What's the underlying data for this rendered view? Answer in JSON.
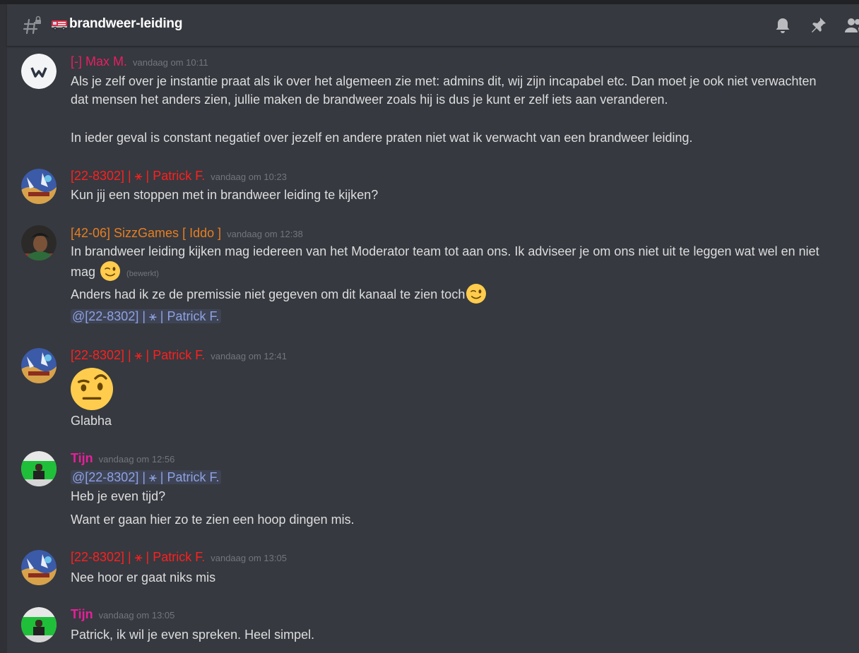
{
  "channel": {
    "name": "brandweer-leiding",
    "icon": "fire-truck-emoji"
  },
  "header_icons": [
    "bell-icon",
    "pin-icon",
    "members-icon"
  ],
  "colors": {
    "background": "#36393f",
    "text": "#dcddde",
    "timestamp": "#72767d",
    "mention": "#8ea1e1",
    "author_max": "#e91e63",
    "author_patrick": "#ff1f1f",
    "author_sizz": "#e67e22",
    "author_tijn": "#e91e9c"
  },
  "messages": [
    {
      "author": "[-] Max M.",
      "time": "vandaag om 10:11",
      "lines": [
        "Als je zelf over je instantie praat als ik over het algemeen zie met: admins dit, wij zijn incapabel etc. Dan moet je ook niet verwachten",
        "dat mensen het anders zien, jullie maken de brandweer zoals hij is dus je kunt er zelf iets aan veranderen.",
        "In ieder geval is constant negatief over jezelf en andere praten niet wat ik verwacht van een brandweer leiding."
      ]
    },
    {
      "author": "[22-8302] | ⚹ | Patrick F.",
      "time": "vandaag om 10:23",
      "lines": [
        "Kun jij een stoppen met in brandweer leiding te kijken?"
      ]
    },
    {
      "author": "[42-06] SizzGames [ Iddo ]",
      "time": "vandaag om 12:38",
      "lines": [
        "In brandweer leiding kijken mag iedereen van het Moderator team tot aan ons. Ik adviseer je om ons niet uit te leggen wat wel en niet",
        "mag",
        "Anders had ik ze de premissie niet gegeven om dit kanaal te zien toch"
      ],
      "edited": "(bewerkt)",
      "mention": "@[22-8302] | ⚹ | Patrick F."
    },
    {
      "author": "[22-8302] | ⚹ | Patrick F.",
      "time": "vandaag om 12:41",
      "emoji": "raised-eyebrow-emoji",
      "lines": [
        "Glabha"
      ]
    },
    {
      "author": "Tijn",
      "time": "vandaag om 12:56",
      "mention": "@[22-8302] | ⚹ | Patrick F.",
      "lines": [
        "Heb je even tijd?",
        "Want er gaan hier zo te zien een hoop dingen mis."
      ]
    },
    {
      "author": "[22-8302] | ⚹ | Patrick F.",
      "time": "vandaag om 13:05",
      "lines": [
        "Nee hoor er gaat niks mis"
      ]
    },
    {
      "author": "Tijn",
      "time": "vandaag om 13:05",
      "lines": [
        "Patrick, ik wil je even spreken. Heel simpel."
      ]
    }
  ]
}
